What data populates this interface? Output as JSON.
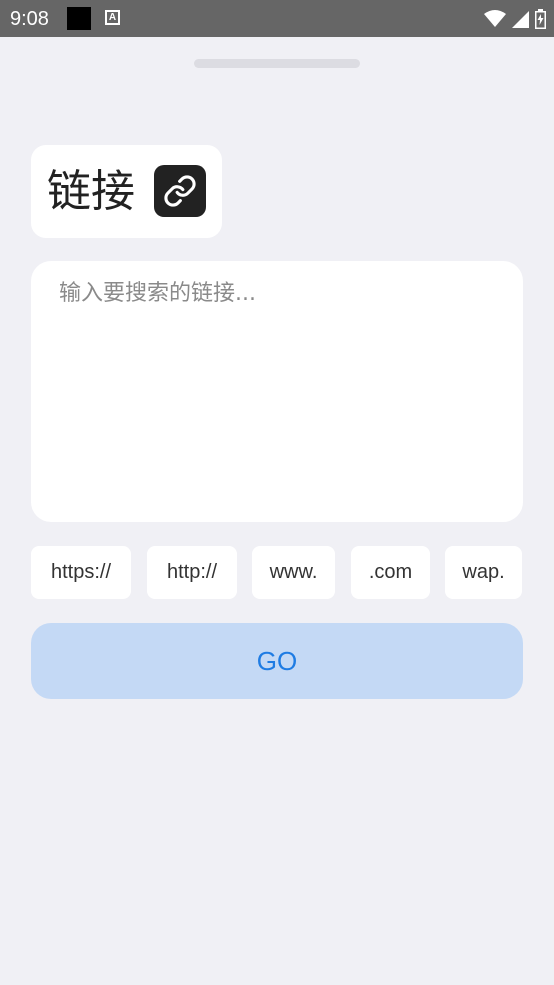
{
  "status_bar": {
    "time": "9:08",
    "notif_letter": "A"
  },
  "card": {
    "title": "链接",
    "icon": "link-icon"
  },
  "input": {
    "placeholder": "输入要搜索的链接..."
  },
  "chips": [
    {
      "label": "https://"
    },
    {
      "label": "http://"
    },
    {
      "label": "www."
    },
    {
      "label": ".com"
    },
    {
      "label": "wap."
    }
  ],
  "go_button": {
    "label": "GO"
  },
  "colors": {
    "background": "#f0f0f5",
    "status_bar": "#666666",
    "button_bg": "#c4d9f5",
    "button_text": "#1f7ce3"
  }
}
